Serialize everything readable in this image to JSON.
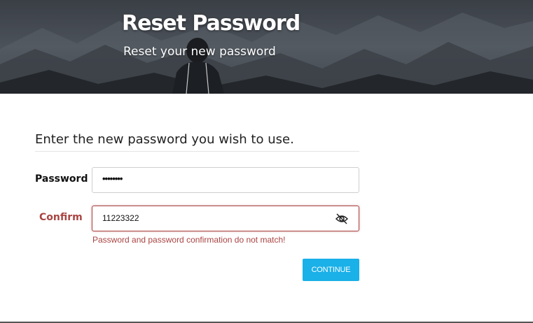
{
  "hero": {
    "title": "Reset Password",
    "subtitle": "Reset your new password"
  },
  "form": {
    "heading": "Enter the new password you wish to use.",
    "password": {
      "label": "Password",
      "value": "••••••••"
    },
    "confirm": {
      "label": "Confirm",
      "value": "11223322",
      "toggle_icon": "eye-slash-icon"
    },
    "error_message": "Password and password confirmation do not match!",
    "continue_label": "CONTINUE"
  },
  "colors": {
    "accent": "#1ab0e8",
    "error": "#a94442",
    "text": "#222222"
  }
}
